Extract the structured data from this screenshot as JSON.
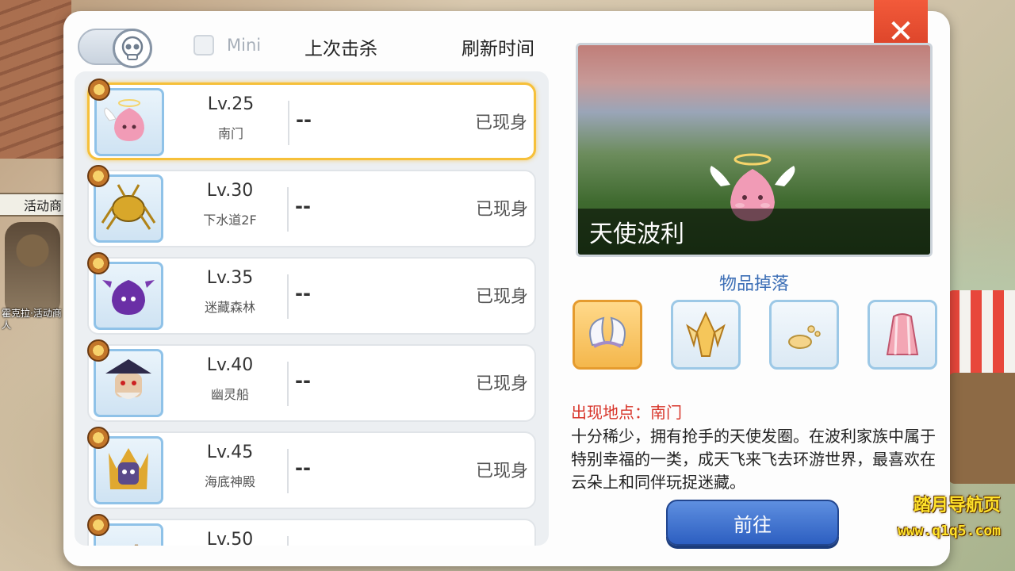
{
  "background": {
    "sign_text": "活动商",
    "npc_name": "霍克拉·活动商人"
  },
  "watermark": {
    "line1": "踏月导航页",
    "line2": "www.q1q5.com"
  },
  "header": {
    "mini_label": "Mini",
    "col_last_kill": "上次击杀",
    "col_refresh": "刷新时间"
  },
  "mvp_list": [
    {
      "level": "Lv.25",
      "map": "南门",
      "last_kill": "--",
      "status": "已现身",
      "icon": "angeling-icon",
      "selected": true
    },
    {
      "level": "Lv.30",
      "map": "下水道2F",
      "last_kill": "--",
      "status": "已现身",
      "icon": "golden-thief-bug-icon",
      "selected": false
    },
    {
      "level": "Lv.35",
      "map": "迷藏森林",
      "last_kill": "--",
      "status": "已现身",
      "icon": "deviling-icon",
      "selected": false
    },
    {
      "level": "Lv.40",
      "map": "幽灵船",
      "last_kill": "--",
      "status": "已现身",
      "icon": "drake-icon",
      "selected": false
    },
    {
      "level": "Lv.45",
      "map": "海底神殿",
      "last_kill": "--",
      "status": "已现身",
      "icon": "strouf-icon",
      "selected": false
    },
    {
      "level": "Lv.50",
      "map": "",
      "last_kill": "",
      "status": "",
      "icon": "mvp-icon",
      "selected": false
    }
  ],
  "detail": {
    "monster_name": "天使波利",
    "drop_title": "物品掉落",
    "drops": [
      "angel-wing-headband-icon",
      "crystal-shard-icon",
      "jellopy-icon",
      "pink-robe-icon"
    ],
    "location": "出现地点：南门",
    "description": "十分稀少，拥有抢手的天使发圈。在波利家族中属于特别幸福的一类，成天飞来飞去环游世界，最喜欢在云朵上和同伴玩捉迷藏。",
    "goto_label": "前往",
    "close_label": "✕"
  },
  "colors": {
    "accent_blue": "#3d6fb6",
    "selected_border": "#f6c03a",
    "location_red": "#d8352a",
    "close_red": "#e24a2e"
  }
}
